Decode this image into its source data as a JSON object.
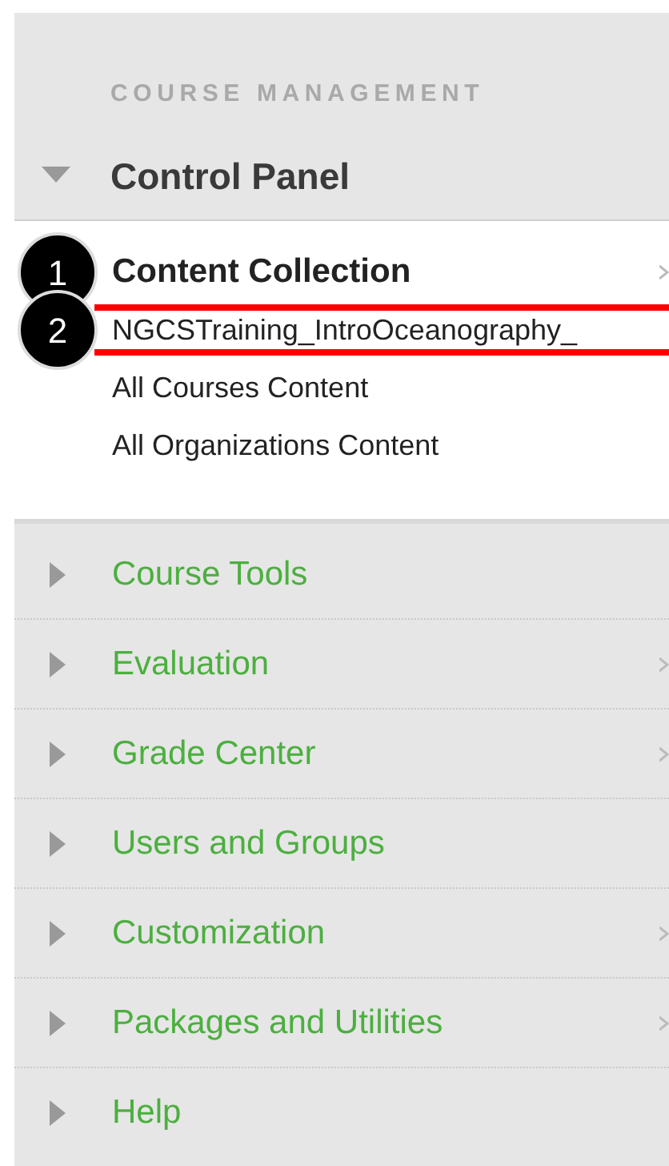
{
  "section_title": "COURSE MANAGEMENT",
  "control_panel": {
    "label": "Control Panel",
    "expanded": true
  },
  "submenu": [
    {
      "label": "Content Collection",
      "bold": true,
      "chevron": true,
      "callout": "1",
      "highlighted": false
    },
    {
      "label": "NGCSTraining_IntroOceanography_",
      "bold": false,
      "chevron": false,
      "callout": "2",
      "highlighted": true
    },
    {
      "label": "All Courses Content",
      "bold": false,
      "chevron": false,
      "highlighted": false
    },
    {
      "label": "All Organizations Content",
      "bold": false,
      "chevron": false,
      "highlighted": false
    }
  ],
  "menu": [
    {
      "label": "Course Tools",
      "chevron": false
    },
    {
      "label": "Evaluation",
      "chevron": true
    },
    {
      "label": "Grade Center",
      "chevron": true
    },
    {
      "label": "Users and Groups",
      "chevron": false
    },
    {
      "label": "Customization",
      "chevron": true
    },
    {
      "label": "Packages and Utilities",
      "chevron": true
    },
    {
      "label": "Help",
      "chevron": false
    }
  ]
}
